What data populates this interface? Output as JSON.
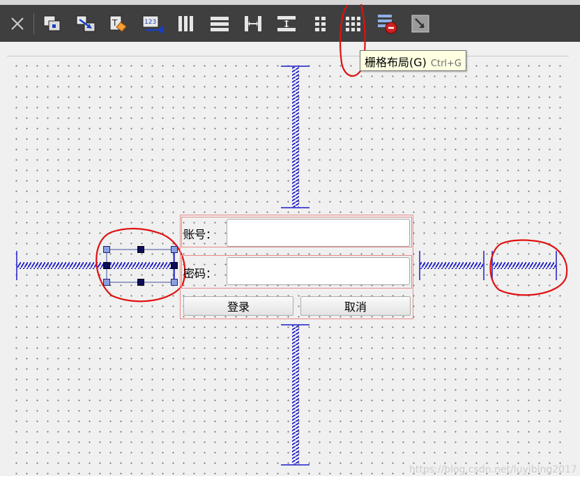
{
  "toolbar": {
    "buttons": [
      {
        "icon": "close-icon",
        "name": "close-form-button"
      },
      {
        "icon": "edit-widgets-icon",
        "name": "edit-widgets-button"
      },
      {
        "icon": "edit-signals-slots-icon",
        "name": "edit-signals-slots-button"
      },
      {
        "icon": "edit-buddies-icon",
        "name": "edit-buddies-button"
      },
      {
        "icon": "edit-tab-order-icon",
        "name": "edit-tab-order-button"
      },
      {
        "icon": "layout-horizontal-icon",
        "name": "layout-horizontal-button"
      },
      {
        "icon": "layout-vertical-icon",
        "name": "layout-vertical-button"
      },
      {
        "icon": "layout-horizontal-splitter-icon",
        "name": "layout-horizontal-splitter-button"
      },
      {
        "icon": "layout-vertical-splitter-icon",
        "name": "layout-vertical-splitter-button"
      },
      {
        "icon": "layout-form-icon",
        "name": "layout-form-button"
      },
      {
        "icon": "layout-grid-icon",
        "name": "layout-grid-button"
      },
      {
        "icon": "break-layout-icon",
        "name": "break-layout-button"
      },
      {
        "icon": "adjust-size-icon",
        "name": "adjust-size-button"
      }
    ]
  },
  "tooltip": {
    "label": "栅格布局(G)",
    "shortcut": "Ctrl+G"
  },
  "form": {
    "account_label": "账号：",
    "password_label": "密码：",
    "account_value": "",
    "password_value": "",
    "login_button": "登录",
    "cancel_button": "取消"
  },
  "colors": {
    "toolbar_bg": "#3f3f3f",
    "spacer_blue": "#1a1ac8",
    "annotation_red": "#e01010",
    "layout_frame": "#e88a8a"
  },
  "watermark": "https://blog.csdn.net/luyibing2017"
}
